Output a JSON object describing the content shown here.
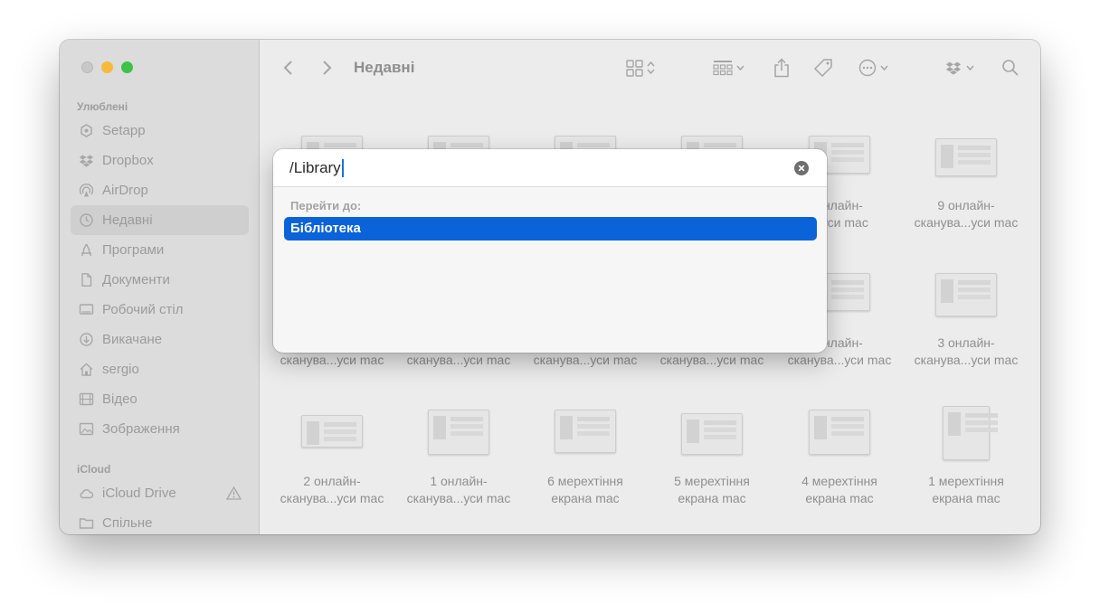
{
  "window": {
    "title": "Недавні"
  },
  "sidebar": {
    "sections": {
      "favorites": "Улюблені",
      "icloud": "iCloud"
    },
    "items": [
      {
        "label": "Setapp",
        "icon": "setapp-icon"
      },
      {
        "label": "Dropbox",
        "icon": "dropbox-icon"
      },
      {
        "label": "AirDrop",
        "icon": "airdrop-icon"
      },
      {
        "label": "Недавні",
        "icon": "clock-icon",
        "selected": true
      },
      {
        "label": "Програми",
        "icon": "applications-icon"
      },
      {
        "label": "Документи",
        "icon": "document-icon"
      },
      {
        "label": "Робочий стіл",
        "icon": "desktop-icon"
      },
      {
        "label": "Викачане",
        "icon": "download-icon"
      },
      {
        "label": "sergio",
        "icon": "home-icon"
      },
      {
        "label": "Відео",
        "icon": "film-icon"
      },
      {
        "label": "Зображення",
        "icon": "photo-icon"
      }
    ],
    "icloud_items": [
      {
        "label": "iCloud Drive",
        "icon": "cloud-icon",
        "warning": "warning-icon"
      },
      {
        "label": "Спільне",
        "icon": "shared-folder-icon"
      }
    ]
  },
  "grid": {
    "row1": [
      {
        "line1": "",
        "line2": ""
      },
      {
        "line1": "",
        "line2": ""
      },
      {
        "line1": "",
        "line2": ""
      },
      {
        "line1": "",
        "line2": ""
      },
      {
        "line1": "онлайн-",
        "line2": "...уси mac"
      },
      {
        "line1": "9 онлайн-",
        "line2": "сканува...уси mac"
      }
    ],
    "row2": [
      {
        "line1": "",
        "line2": "сканува...уси mac"
      },
      {
        "line1": "",
        "line2": "сканува...уси mac"
      },
      {
        "line1": "",
        "line2": "сканува...уси mac"
      },
      {
        "line1": "",
        "line2": "сканува...уси mac"
      },
      {
        "line1": "онлайн-",
        "line2": "сканува...уси mac"
      },
      {
        "line1": "3 онлайн-",
        "line2": "сканува...уси mac"
      }
    ],
    "row3": [
      {
        "line1": "2 онлайн-",
        "line2": "сканува...уси mac"
      },
      {
        "line1": "1 онлайн-",
        "line2": "сканува...уси mac"
      },
      {
        "line1": "6 мерехтіння",
        "line2": "екрана mac"
      },
      {
        "line1": "5 мерехтіння",
        "line2": "екрана mac"
      },
      {
        "line1": "4 мерехтіння",
        "line2": "екрана mac"
      },
      {
        "line1": "1 мерехтіння",
        "line2": "екрана mac"
      }
    ]
  },
  "goto_dialog": {
    "input_value": "/Library",
    "section_label": "Перейти до:",
    "results": [
      {
        "label": "Бібліотека",
        "selected": true
      }
    ]
  },
  "colors": {
    "accent": "#0a63d8",
    "traffic_min": "#f6b93a",
    "traffic_max": "#3ec24a"
  }
}
